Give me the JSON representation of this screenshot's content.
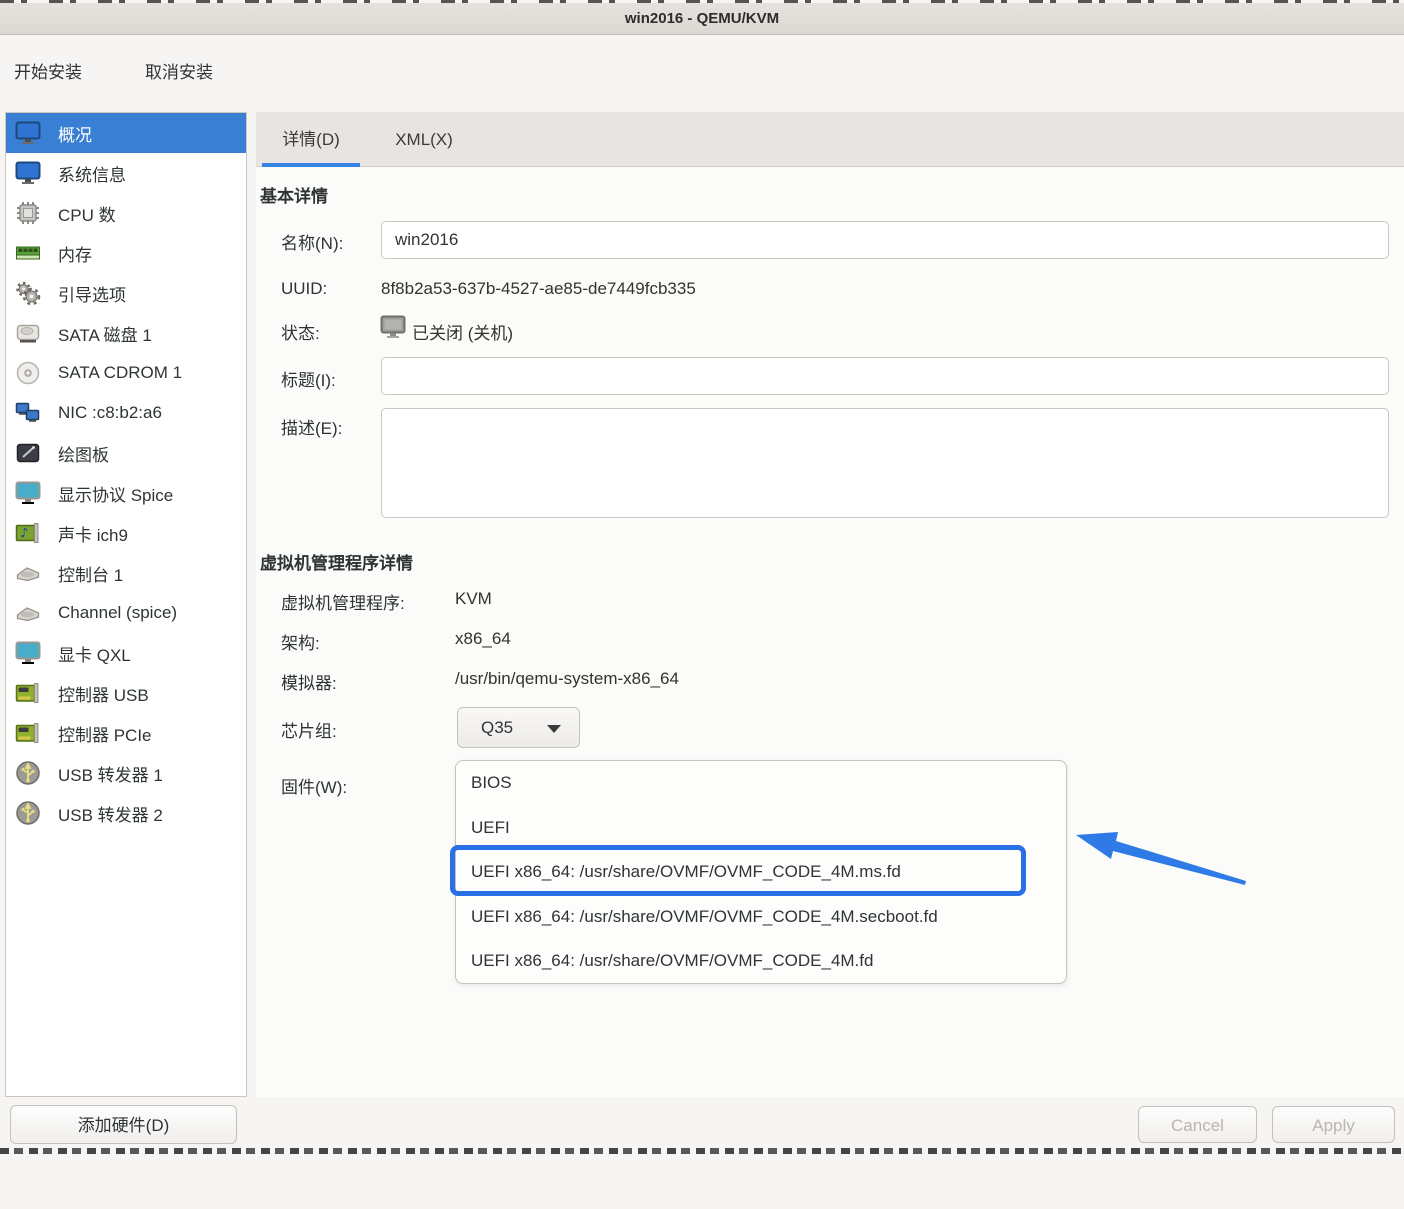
{
  "window": {
    "title": "win2016 - QEMU/KVM"
  },
  "toolbar": {
    "begin_install_label": "开始安装",
    "cancel_install_label": "取消安装"
  },
  "sidebar": {
    "items": [
      {
        "key": "overview",
        "label": "概况",
        "icon": "monitor-blue",
        "selected": true
      },
      {
        "key": "os-info",
        "label": "系统信息",
        "icon": "monitor-blue",
        "selected": false
      },
      {
        "key": "cpus",
        "label": "CPU 数",
        "icon": "cpu",
        "selected": false
      },
      {
        "key": "memory",
        "label": "内存",
        "icon": "memory",
        "selected": false
      },
      {
        "key": "boot-options",
        "label": "引导选项",
        "icon": "gears",
        "selected": false
      },
      {
        "key": "sata-disk-1",
        "label": "SATA 磁盘 1",
        "icon": "disk",
        "selected": false
      },
      {
        "key": "sata-cdrom-1",
        "label": "SATA CDROM 1",
        "icon": "cdrom",
        "selected": false
      },
      {
        "key": "nic",
        "label": "NIC :c8:b2:a6",
        "icon": "nic",
        "selected": false
      },
      {
        "key": "tablet",
        "label": "绘图板",
        "icon": "tablet",
        "selected": false
      },
      {
        "key": "display-spice",
        "label": "显示协议 Spice",
        "icon": "monitor-cyan",
        "selected": false
      },
      {
        "key": "sound-ich9",
        "label": "声卡 ich9",
        "icon": "soundcard",
        "selected": false
      },
      {
        "key": "console-1",
        "label": "控制台 1",
        "icon": "serial",
        "selected": false
      },
      {
        "key": "channel-spice",
        "label": "Channel (spice)",
        "icon": "serial",
        "selected": false
      },
      {
        "key": "video-qxl",
        "label": "显卡 QXL",
        "icon": "monitor-cyan",
        "selected": false
      },
      {
        "key": "controller-usb",
        "label": "控制器 USB",
        "icon": "pci-card",
        "selected": false
      },
      {
        "key": "controller-pcie",
        "label": "控制器 PCIe",
        "icon": "pci-card",
        "selected": false
      },
      {
        "key": "usb-redirector-1",
        "label": "USB 转发器 1",
        "icon": "usb",
        "selected": false
      },
      {
        "key": "usb-redirector-2",
        "label": "USB 转发器 2",
        "icon": "usb",
        "selected": false
      }
    ],
    "add_hardware_label": "添加硬件(D)"
  },
  "tabs": {
    "details_label": "详情(D)",
    "xml_label": "XML(X)"
  },
  "basic_details": {
    "section_title": "基本详情",
    "name_label": "名称(N):",
    "name_value": "win2016",
    "uuid_label": "UUID:",
    "uuid_value": "8f8b2a53-637b-4527-ae85-de7449fcb335",
    "status_label": "状态:",
    "status_value": "已关闭 (关机)",
    "title_label": "标题(I):",
    "title_value": "",
    "description_label": "描述(E):",
    "description_value": ""
  },
  "hypervisor_details": {
    "section_title": "虚拟机管理程序详情",
    "hypervisor_label": "虚拟机管理程序:",
    "hypervisor_value": "KVM",
    "arch_label": "架构:",
    "arch_value": "x86_64",
    "emulator_label": "模拟器:",
    "emulator_value": "/usr/bin/qemu-system-x86_64",
    "chipset_label": "芯片组:",
    "chipset_value": "Q35",
    "firmware_label": "固件(W):",
    "firmware_options": [
      "BIOS",
      "UEFI",
      "UEFI x86_64: /usr/share/OVMF/OVMF_CODE_4M.ms.fd",
      "UEFI x86_64: /usr/share/OVMF/OVMF_CODE_4M.secboot.fd",
      "UEFI x86_64: /usr/share/OVMF/OVMF_CODE_4M.fd"
    ]
  },
  "annotation": {
    "highlighted_firmware_option": "UEFI x86_64: /usr/share/OVMF/OVMF_CODE_4M.ms.fd",
    "highlighted_index": 2,
    "color": "#2b6fe6"
  },
  "footer": {
    "cancel_label": "Cancel",
    "apply_label": "Apply"
  },
  "colors": {
    "selection_blue": "#3980d4",
    "tab_underline": "#3584e4",
    "annotation_blue": "#2b6fe6"
  }
}
